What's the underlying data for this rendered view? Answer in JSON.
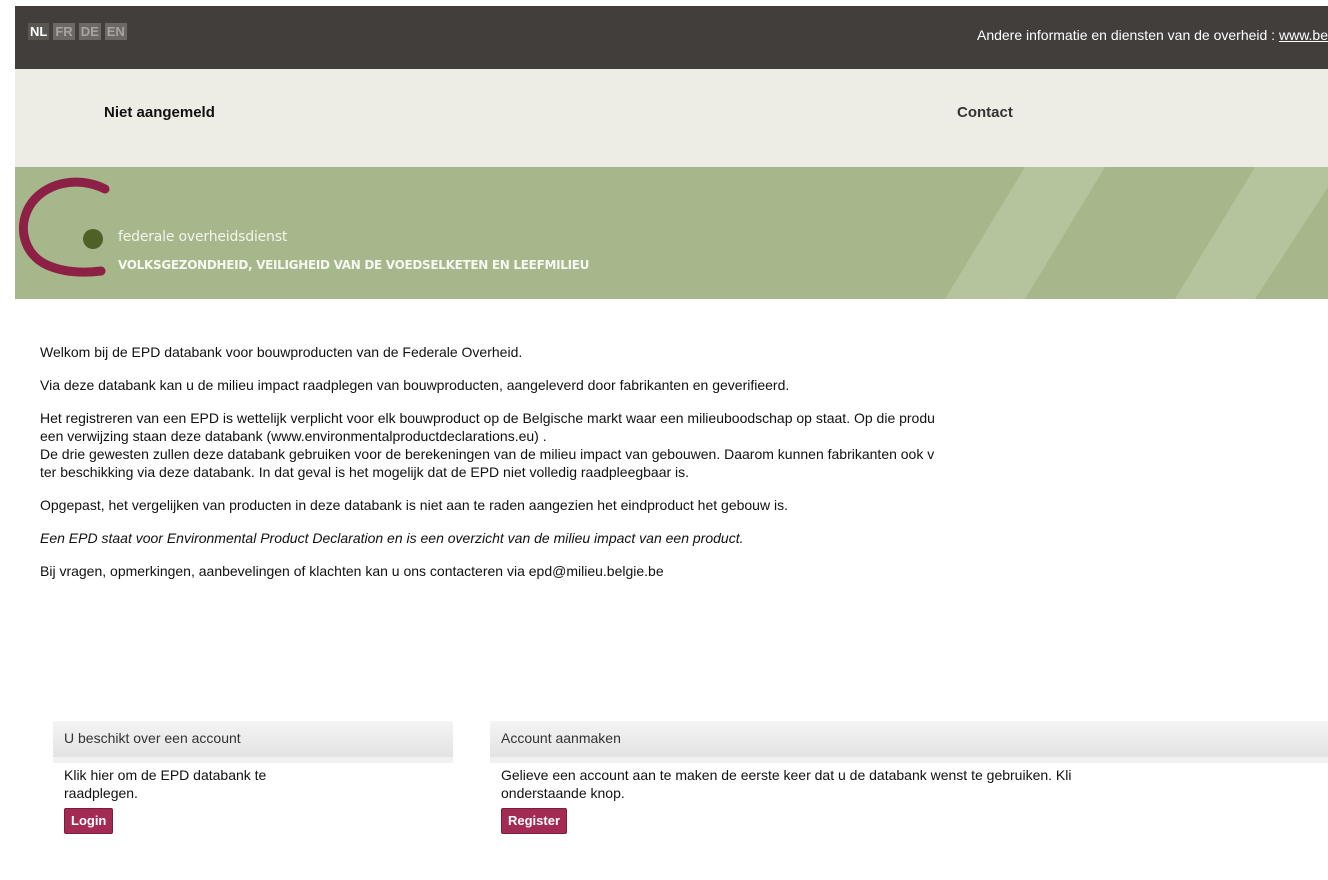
{
  "topbar": {
    "languages": [
      "NL",
      "FR",
      "DE",
      "EN"
    ],
    "info_text": "Andere informatie en diensten van de overheid : ",
    "info_link": "www.be"
  },
  "nav": {
    "status": "Niet aangemeld",
    "contact": "Contact"
  },
  "banner": {
    "line1": "federale overheidsdienst",
    "line2": "VOLKSGEZONDHEID, VEILIGHEID VAN DE VOEDSELKETEN EN LEEFMILIEU",
    "colors": {
      "background": "#a6b78b",
      "logo_arc": "#8c2145",
      "logo_dot": "#4e6127"
    }
  },
  "content": {
    "p1": "Welkom bij de EPD databank voor bouwproducten van de Federale Overheid.",
    "p2": "Via deze databank kan u de milieu impact raadplegen van bouwproducten, aangeleverd door fabrikanten en geverifieerd.",
    "p3_l1": "Het registreren van een EPD is wettelijk verplicht voor elk bouwproduct op de Belgische markt waar een milieuboodschap op staat. Op die produ",
    "p3_l2": "een verwijzing staan deze databank (www.environmentalproductdeclarations.eu) .",
    "p3_l3": "De drie gewesten zullen deze databank gebruiken voor de berekeningen van de milieu impact van gebouwen. Daarom kunnen fabrikanten ook v",
    "p3_l4": "ter beschikking via deze databank. In dat geval is het mogelijk dat de EPD niet volledig raadpleegbaar is.",
    "p4": "Opgepast, het vergelijken van producten in deze databank is niet aan te raden aangezien het eindproduct het gebouw is.",
    "p5": "Een EPD staat voor Environmental Product Declaration en is een overzicht van de milieu impact van een product.",
    "p6": "Bij vragen, opmerkingen, aanbevelingen of klachten kan u ons contacteren via epd@milieu.belgie.be"
  },
  "login_box": {
    "title": "U beschikt over een account",
    "text_l1": "Klik hier om de EPD databank te",
    "text_l2": "raadplegen.",
    "button": "Login"
  },
  "register_box": {
    "title": "Account aanmaken",
    "text_l1": "Gelieve een account aan te maken de eerste keer dat u de databank wenst te gebruiken. Kli",
    "text_l2": "onderstaande knop.",
    "button": "Register"
  },
  "accent_color": "#a32a52"
}
